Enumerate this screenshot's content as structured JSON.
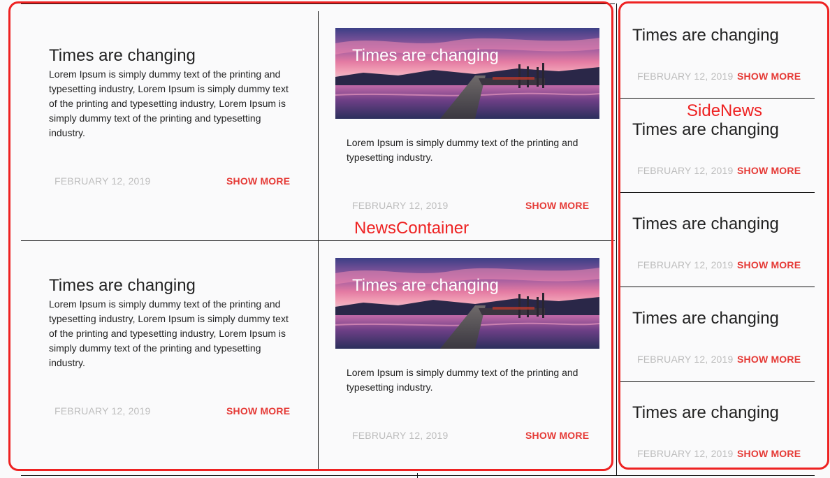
{
  "colors": {
    "accent": "#e53935",
    "date": "#bdbdbd",
    "annotation": "#ee2222"
  },
  "annotations": {
    "news_container": "NewsContainer",
    "side_news": "SideNews"
  },
  "news": [
    {
      "title": "Times are changing",
      "body": "Lorem Ipsum is simply dummy text of the printing and typesetting industry, Lorem Ipsum is simply dummy text of the printing and typesetting industry, Lorem Ipsum is simply dummy text of the printing and typesetting industry.",
      "date": "FEBRUARY 12, 2019",
      "action": "SHOW MORE"
    },
    {
      "title": "Times are changing",
      "body": "Lorem Ipsum is simply dummy text of the printing and typesetting industry.",
      "date": "FEBRUARY 12, 2019",
      "action": "SHOW MORE",
      "image": "lake-pier-sunset"
    },
    {
      "title": "Times are changing",
      "body": "Lorem Ipsum is simply dummy text of the printing and typesetting industry, Lorem Ipsum is simply dummy text of the printing and typesetting industry, Lorem Ipsum is simply dummy text of the printing and typesetting industry.",
      "date": "FEBRUARY 12, 2019",
      "action": "SHOW MORE"
    },
    {
      "title": "Times are changing",
      "body": "Lorem Ipsum is simply dummy text of the printing and typesetting industry.",
      "date": "FEBRUARY 12, 2019",
      "action": "SHOW MORE",
      "image": "lake-pier-sunset"
    }
  ],
  "side": [
    {
      "title": "Times are changing",
      "date": "FEBRUARY 12, 2019",
      "action": "SHOW MORE"
    },
    {
      "title": "Times are changing",
      "date": "FEBRUARY 12, 2019",
      "action": "SHOW MORE"
    },
    {
      "title": "Times are changing",
      "date": "FEBRUARY 12, 2019",
      "action": "SHOW MORE"
    },
    {
      "title": "Times are changing",
      "date": "FEBRUARY 12, 2019",
      "action": "SHOW MORE"
    },
    {
      "title": "Times are changing",
      "date": "FEBRUARY 12, 2019",
      "action": "SHOW MORE"
    }
  ]
}
